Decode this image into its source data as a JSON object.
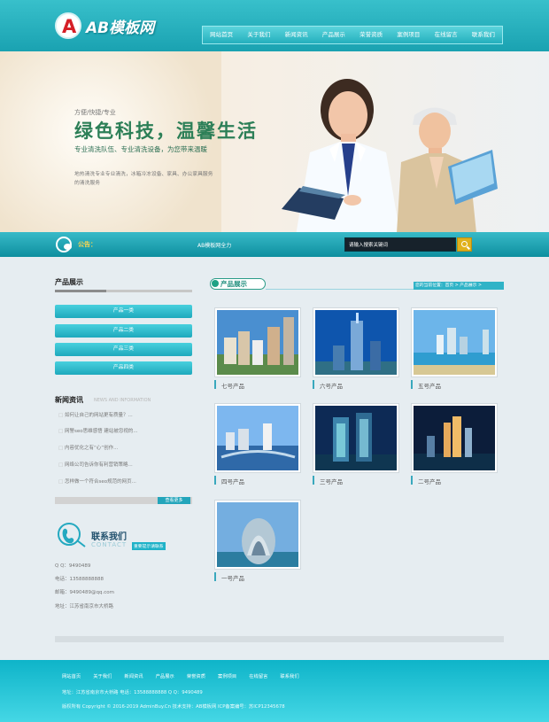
{
  "site": {
    "name": "AB模板网"
  },
  "nav": [
    "网站首页",
    "关于我们",
    "新闻资讯",
    "产品展示",
    "荣誉资质",
    "案例项目",
    "在线留言",
    "联系我们"
  ],
  "banner": {
    "small": "方便/快捷/专业",
    "main": "绿色科技，温馨生活",
    "sub": "专业清洗队伍、专业清洗设备，为您带来温暖",
    "desc": "地热清洗专业专业清洗，冰箱冷冻设备、家具、办公家具服务的清洗服务"
  },
  "notice": {
    "label": "公告：",
    "text": "AB模板网全力"
  },
  "search": {
    "placeholder": "请输入搜索关键词"
  },
  "left": {
    "product_title": "产品展示",
    "categories": [
      "产品一类",
      "产品二类",
      "产品三类",
      "产品四类"
    ],
    "news_title": "新闻资讯",
    "news_subtitle": "NEWS AND INFORMATION",
    "news": [
      "如何让自己的网站更有质量？...",
      "网警seo思维感悟 建站被忽视的...",
      "内容优化之有“心”创作...",
      "网络公司告诉你有利营销策略...",
      "怎样做一个符合seo规范的网页..."
    ],
    "more": "查看更多",
    "contact_title": "联系我们",
    "contact_en": "CONTACT",
    "contact_tag": "重要提示请联系",
    "contact_lines": [
      "Q Q：9490489",
      "电话：13588888888",
      "邮箱：9490489@qq.com",
      "地址：江苏省南京市大桥路"
    ]
  },
  "main": {
    "title": "产品展示",
    "breadcrumb": "您的当前位置：首页 > 产品展示 >",
    "products": [
      "七号产品",
      "六号产品",
      "五号产品",
      "四号产品",
      "三号产品",
      "二号产品",
      "一号产品"
    ]
  },
  "footer": {
    "nav": [
      "网站首页",
      "关于我们",
      "新闻资讯",
      "产品展示",
      "荣誉资质",
      "案例项目",
      "在线留言",
      "联系我们"
    ],
    "info": "地址：江苏省南京市大桥路   电话：13588888888   Q Q：9490489",
    "copyright": "版权所有 Copyright © 2016-2019 AdminBuy.Cn 技术支持：AB模板网 ICP备案编号：苏ICP12345678"
  }
}
